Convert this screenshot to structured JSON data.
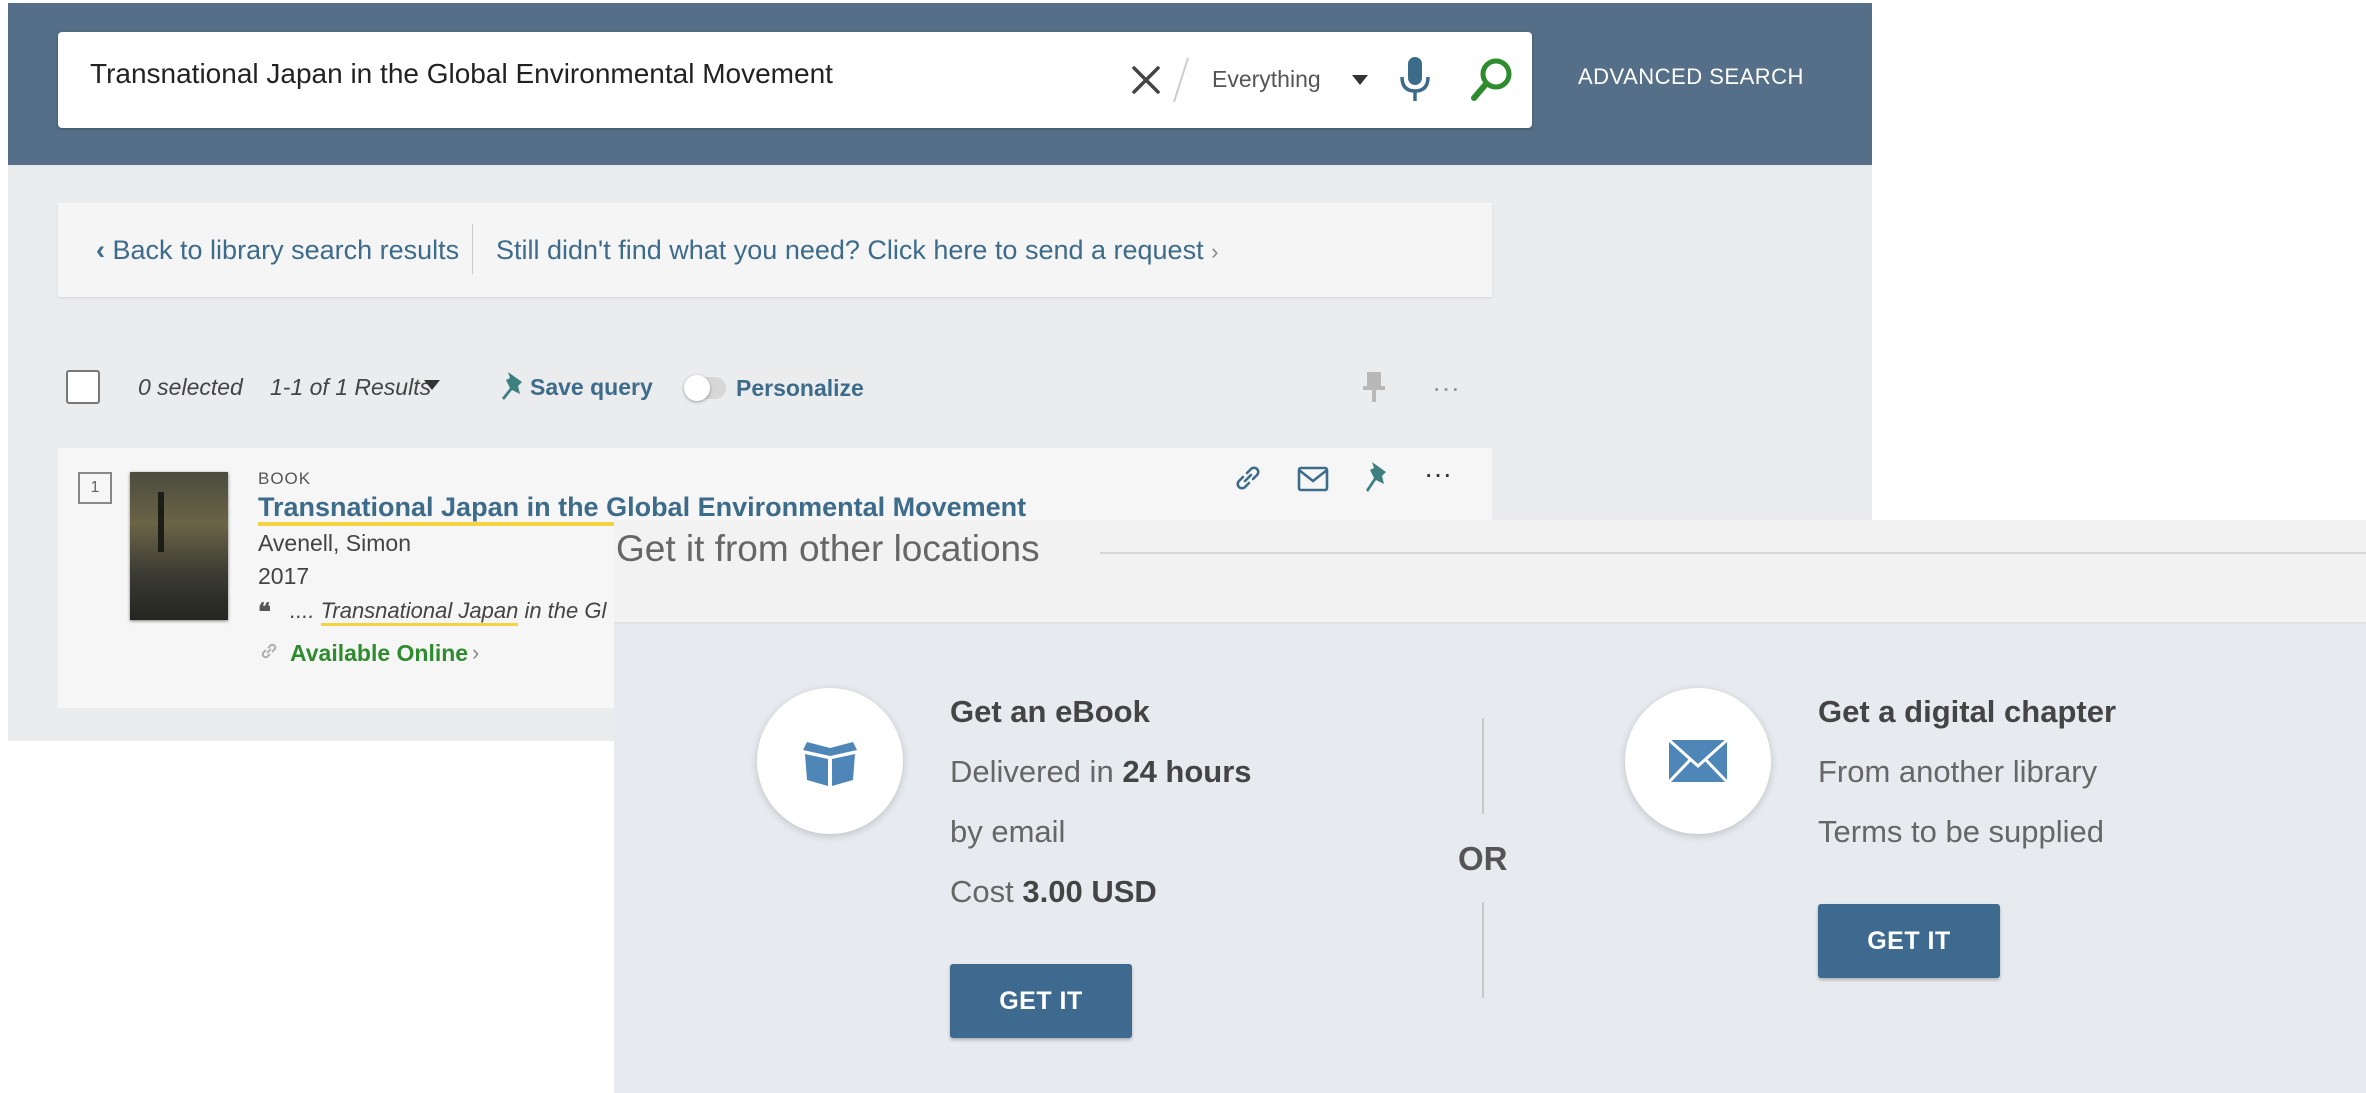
{
  "header": {
    "search_query": "Transnational Japan in the Global Environmental Movement",
    "scope": "Everything",
    "advanced_search": "ADVANCED SEARCH"
  },
  "breadcrumb": {
    "back": "Back to library search results",
    "request": "Still didn't find what you need? Click here to send a request"
  },
  "toolbar": {
    "selected": "0 selected",
    "results": "1-1 of 1 Results",
    "save_query": "Save query",
    "personalize": "Personalize"
  },
  "result": {
    "index": "1",
    "type": "BOOK",
    "title": "Transnational Japan in the Global Environmental Movement",
    "author": "Avenell, Simon",
    "year": "2017",
    "snippet_prefix": "....",
    "snippet_highlight": "Transnational Japan",
    "snippet_rest": "in the Gl",
    "availability": "Available Online"
  },
  "overlay": {
    "title": "Get it from other locations",
    "or": "OR",
    "ebook": {
      "title": "Get an eBook",
      "line1_prefix": "Delivered in",
      "line1_bold": "24 hours",
      "line2": "by email",
      "cost_label": "Cost",
      "cost_value": "3.00",
      "cost_currency": "USD",
      "button": "GET IT"
    },
    "chapter": {
      "title": "Get a digital chapter",
      "line1": "From another library",
      "line2": "Terms to be supplied",
      "button": "GET IT"
    }
  },
  "colors": {
    "header_bg": "#546f87",
    "link": "#3d6b8a",
    "available": "#2e8b2e",
    "highlight": "#f4d340",
    "button": "#3e6a8f",
    "icon_blue": "#4e86b8"
  }
}
